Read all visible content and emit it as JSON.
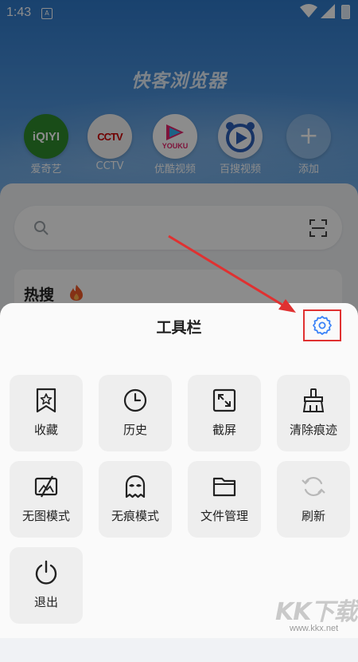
{
  "status_bar": {
    "time": "1:43",
    "notification_badge": "A"
  },
  "browser": {
    "title": "快客浏览器",
    "shortcuts": [
      {
        "label": "爱奇艺",
        "icon": "iqiyi-logo",
        "logo_text": "iQIYI"
      },
      {
        "label": "CCTV",
        "icon": "cctv-logo",
        "logo_text": "CCTV"
      },
      {
        "label": "优酷视频",
        "icon": "youku-logo",
        "logo_text": "YOUKU"
      },
      {
        "label": "百搜视频",
        "icon": "baisou-logo"
      },
      {
        "label": "添加",
        "icon": "plus-icon",
        "logo_text": "+"
      }
    ],
    "hot_search_title": "热搜"
  },
  "toolbar": {
    "title": "工具栏",
    "settings_icon": "gear-icon",
    "items": [
      {
        "label": "收藏",
        "icon": "bookmark-star-icon"
      },
      {
        "label": "历史",
        "icon": "clock-icon"
      },
      {
        "label": "截屏",
        "icon": "screenshot-icon"
      },
      {
        "label": "清除痕迹",
        "icon": "broom-icon"
      },
      {
        "label": "无图模式",
        "icon": "no-image-icon"
      },
      {
        "label": "无痕模式",
        "icon": "ghost-icon"
      },
      {
        "label": "文件管理",
        "icon": "folder-icon"
      },
      {
        "label": "刷新",
        "icon": "refresh-icon"
      },
      {
        "label": "退出",
        "icon": "power-icon"
      }
    ]
  },
  "watermark": {
    "text": "KK下载",
    "url": "www.kkx.net"
  },
  "colors": {
    "accent": "#3a82f7",
    "highlight_box": "#e03131",
    "hero": "#2f79c9"
  }
}
